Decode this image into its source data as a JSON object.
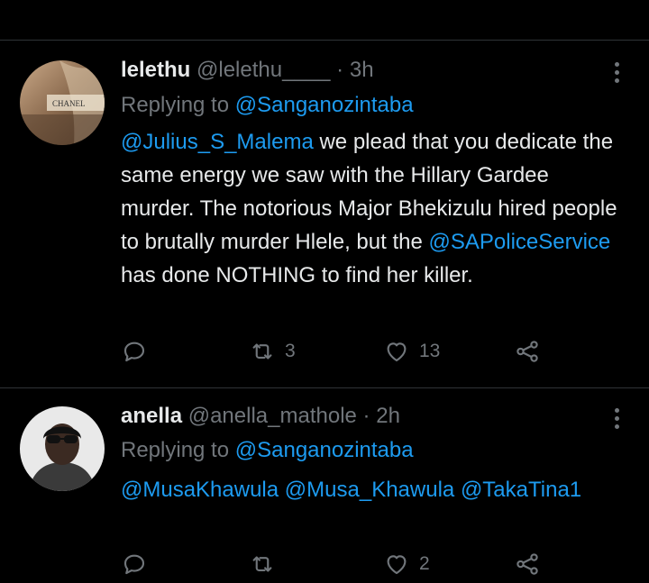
{
  "tweets": [
    {
      "display_name": "lelethu",
      "handle": "@lelethu____",
      "separator": "·",
      "time": "3h",
      "replying_prefix": "Replying to",
      "replying_to": "@Sanganozintaba",
      "avatar_text": "CHANEL",
      "body": {
        "mention1": "@Julius_S_Malema",
        "text1": " we plead that you dedicate the same energy we saw with the Hillary Gardee murder. The notorious Major Bhekizulu hired people to brutally murder Hlele, but the ",
        "mention2": "@SAPoliceService",
        "text2": " has done NOTHING to find her killer."
      },
      "retweets": "3",
      "likes": "13"
    },
    {
      "display_name": "anella",
      "handle": "@anella_mathole",
      "separator": "·",
      "time": "2h",
      "replying_prefix": "Replying to",
      "replying_to": "@Sanganozintaba",
      "body": {
        "mention1": "@MusaKhawula",
        "text1": " ",
        "mention2": "@Musa_Khawula",
        "text2": " ",
        "mention3": "@TakaTina1"
      },
      "retweets": "",
      "likes": "2"
    }
  ],
  "colors": {
    "background": "#000000",
    "text": "#e7e9ea",
    "muted": "#71767b",
    "link": "#1d9bf0",
    "divider": "#2f3336"
  },
  "icons": [
    "reply-icon",
    "retweet-icon",
    "like-icon",
    "share-icon",
    "more-options-icon"
  ]
}
